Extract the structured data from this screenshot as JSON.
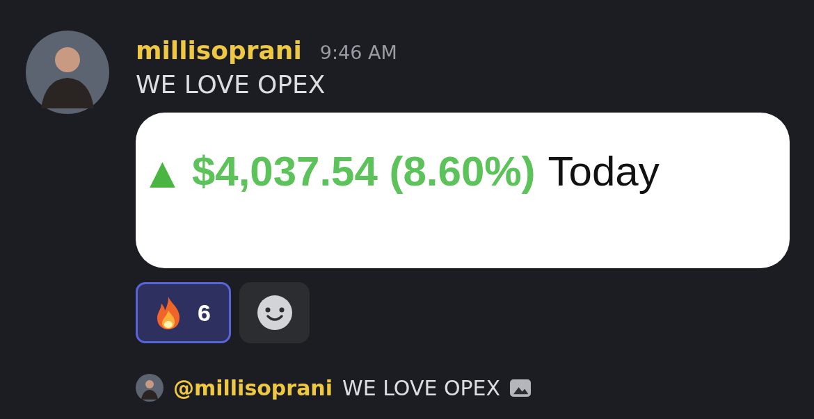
{
  "message": {
    "author": "millisoprani",
    "time": "9:46 AM",
    "text": "WE LOVE OPEX",
    "embed": {
      "kind": "picture-card",
      "arrow": "▲",
      "amount": "$4,037.54 (8.60%)",
      "period": "Today"
    },
    "reactions": [
      {
        "count": "6",
        "selected": true
      }
    ]
  },
  "reply_preview": {
    "mention": "@millisoprani",
    "text": "WE LOVE OPEX"
  }
}
